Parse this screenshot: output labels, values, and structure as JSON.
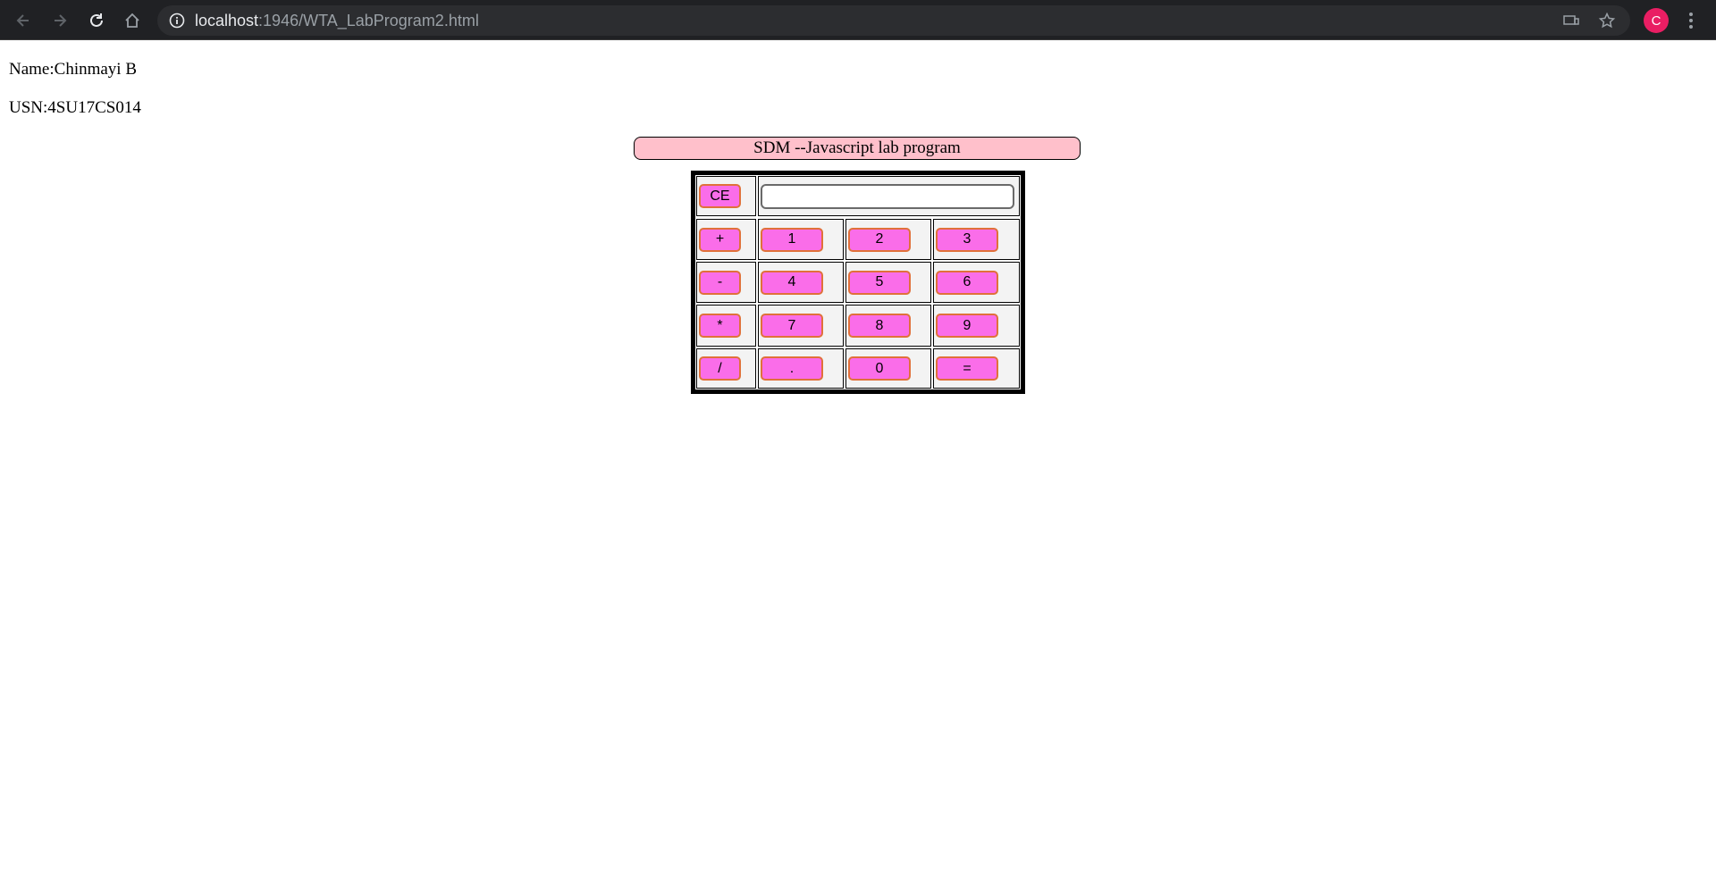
{
  "browser": {
    "url_host": "localhost",
    "url_rest": ":1946/WTA_LabProgram2.html",
    "profile_initial": "C"
  },
  "student": {
    "name_line": "Name:Chinmayi B",
    "usn_line": "USN:4SU17CS014"
  },
  "banner": {
    "title": "SDM --Javascript lab program"
  },
  "calculator": {
    "clear_label": "CE",
    "display_value": "",
    "keys": {
      "plus": "+",
      "minus": "-",
      "multiply": "*",
      "divide": "/",
      "one": "1",
      "two": "2",
      "three": "3",
      "four": "4",
      "five": "5",
      "six": "6",
      "seven": "7",
      "eight": "8",
      "nine": "9",
      "dot": ".",
      "zero": "0",
      "equals": "="
    }
  },
  "colors": {
    "key_fill": "#fa6de9",
    "key_border": "#e0713a",
    "banner_fill": "#ffc0cb",
    "avatar": "#e91e63"
  }
}
